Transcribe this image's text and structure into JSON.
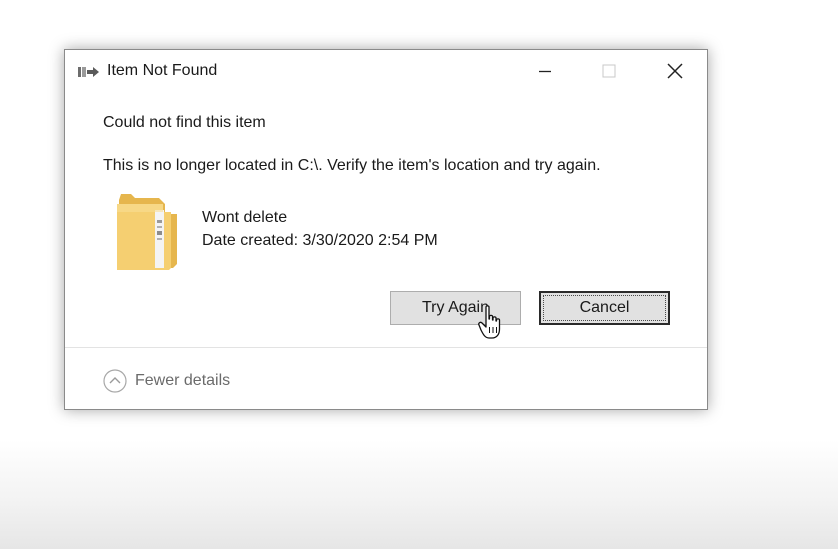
{
  "dialog": {
    "title": "Item Not Found",
    "heading": "Could not find this item",
    "message": "This is no longer located in C:\\. Verify the item's location and try again.",
    "item": {
      "name": "Wont delete",
      "date_created": "Date created: 3/30/2020 2:54 PM"
    },
    "buttons": {
      "try_again": "Try Again",
      "cancel": "Cancel"
    },
    "details_toggle": "Fewer details"
  },
  "icons": {
    "title": "file-move-icon",
    "minimize": "minimize-icon",
    "maximize": "maximize-icon",
    "close": "close-icon",
    "item": "folder-icon",
    "details": "chevron-up-circle-icon",
    "pointer": "hand-cursor-icon"
  },
  "colors": {
    "folder": "#f5cf71",
    "folder_dark": "#e6b64d",
    "button_face": "#e1e1e1",
    "default_button_border": "#2a2a2a"
  }
}
